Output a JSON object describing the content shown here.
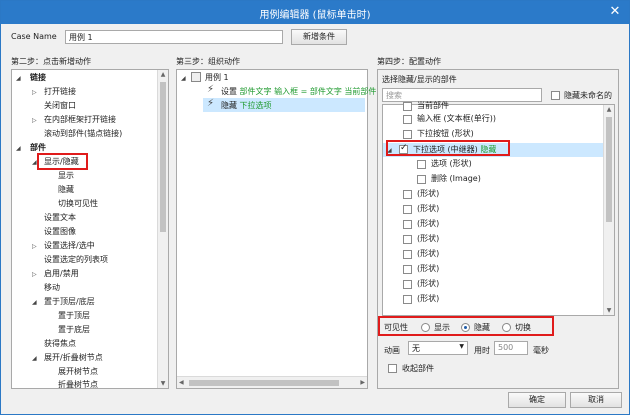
{
  "window": {
    "title": "用例编辑器 (鼠标单击时)",
    "close": "✕"
  },
  "case": {
    "label": "Case Name",
    "value": "用例 1",
    "add_button": "新增条件"
  },
  "step2": {
    "title": "第二步：点击新增动作",
    "groups": [
      {
        "label": "链接",
        "items": [
          "打开链接",
          "关闭窗口",
          "在内部框架打开链接",
          "滚动到部件(锚点链接)"
        ]
      },
      {
        "label": "部件",
        "items": [
          "显示/隐藏",
          "显示",
          "隐藏",
          "切换可见性",
          "设置文本",
          "设置图像",
          "设置选择/选中",
          "设置选定的列表项",
          "启用/禁用",
          "移动",
          "置于顶层/底层",
          "置于顶层",
          "置于底层",
          "获得焦点",
          "展开/折叠树节点",
          "展开树节点",
          "折叠树节点"
        ]
      }
    ]
  },
  "step3": {
    "title": "第三步：组织动作",
    "case_label": "用例 1",
    "action1_prefix": "设置",
    "action1_text": "部件文字 输入框 = 部件文字 当前部件",
    "action2_prefix": "隐藏",
    "action2_text": "下拉选项"
  },
  "step4": {
    "title": "第四步：配置动作",
    "subtitle": "选择隐藏/显示的部件",
    "search_placeholder": "搜索",
    "hide_unnamed": "隐藏未命名的",
    "widgets": [
      "当前部件",
      "输入框 (文本框(单行))",
      "下拉按钮 (形状)",
      "下拉选项 (中继器)",
      "隐藏",
      "选项 (形状)",
      "删除 (Image)",
      "(形状)"
    ],
    "visibility_label": "可见性",
    "show": "显示",
    "hide": "隐藏",
    "toggle": "切换",
    "anim_label": "动画",
    "anim_value": "无",
    "duration_label": "用时",
    "duration_value": "500",
    "ms": "毫秒",
    "bring_front": "收起部件"
  },
  "buttons": {
    "ok": "确定",
    "cancel": "取消"
  },
  "colors": {
    "title_bar": "#2b7ac9",
    "highlight": "#e01b1b",
    "green_text": "#1f9a2f"
  }
}
